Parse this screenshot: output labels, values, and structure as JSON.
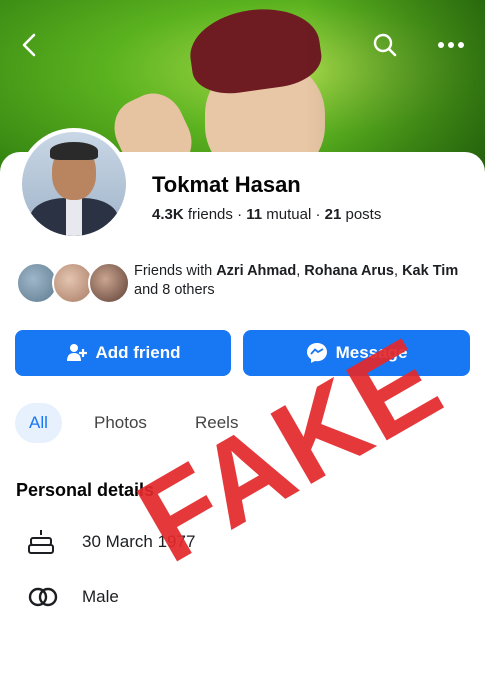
{
  "profile": {
    "name": "Tokmat Hasan",
    "friends_count": "4.3K",
    "friends_label": "friends",
    "mutual_count": "11",
    "mutual_label": "mutual",
    "posts_count": "21",
    "posts_label": "posts"
  },
  "mutual_friends": {
    "prefix": "Friends with",
    "names": [
      "Azri Ahmad",
      "Rohana Arus",
      "Kak Tim"
    ],
    "suffix": "and 8 others"
  },
  "actions": {
    "add_friend": "Add friend",
    "message": "Message"
  },
  "tabs": [
    {
      "label": "All",
      "active": true
    },
    {
      "label": "Photos",
      "active": false
    },
    {
      "label": "Reels",
      "active": false
    }
  ],
  "personal_details": {
    "title": "Personal details",
    "birthday": "30 March 1977",
    "gender": "Male"
  },
  "overlay": {
    "stamp": "FAKE"
  },
  "icons": [
    "back-icon",
    "search-icon",
    "more-icon",
    "add-friend-icon",
    "messenger-icon",
    "birthday-cake-icon",
    "gender-icon"
  ],
  "colors": {
    "accent": "#1877f2",
    "stamp": "#e3282b",
    "tab_active_bg": "#e7f0fd"
  }
}
